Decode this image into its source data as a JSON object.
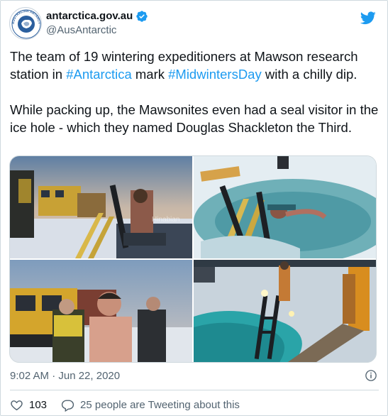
{
  "account": {
    "display_name": "antarctica.gov.au",
    "handle": "@AusAntarctic",
    "avatar_icon": "australian-antarctic-program-logo",
    "avatar_text": "AUSTRALIAN ANTARCTIC PROGRAM",
    "verified_icon": "verified-badge-icon"
  },
  "tweet": {
    "para1_before": "The team of 19 wintering expeditioners at Mawson research station in ",
    "hashtag1": "#Antarctica",
    "para1_middle": " mark ",
    "hashtag2": "#MidwintersDay",
    "para1_after": " with a chilly dip.",
    "para2": "While packing up, the Mawsonites even had a seal visitor in the ice hole - which they named Douglas Shackleton the Third."
  },
  "media": {
    "photos": [
      {
        "icon": "photo-expeditioner-climbing-ladder-into-ice-hole"
      },
      {
        "icon": "photo-swimmer-in-ice-hole"
      },
      {
        "icon": "photo-shirtless-expeditioner-by-yellow-vehicle"
      },
      {
        "icon": "photo-ice-hole-with-ladder-at-night"
      }
    ],
    "watermark": "Hinabian"
  },
  "meta": {
    "timestamp": "9:02 AM · Jun 22, 2020",
    "info_icon": "info-icon"
  },
  "actions": {
    "like_count": "103",
    "conversation_text": "25 people are Tweeting about this"
  },
  "colors": {
    "accent": "#1d9bf0",
    "text": "#0f1419",
    "secondary": "#536471"
  }
}
